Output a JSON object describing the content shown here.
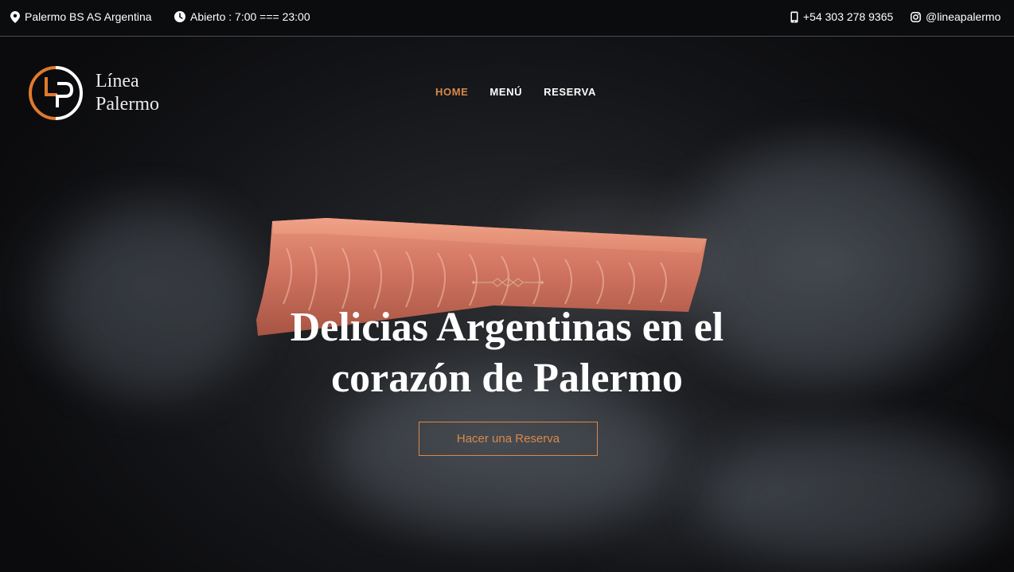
{
  "topbar": {
    "location": "Palermo BS AS Argentina",
    "hours": "Abierto : 7:00 === 23:00",
    "phone": "+54 303 278 9365",
    "instagram": "@lineapalermo"
  },
  "logo": {
    "line1": "Línea",
    "line2": "Palermo",
    "accent_color": "#e07a2e"
  },
  "nav": {
    "items": [
      {
        "label": "HOME",
        "active": true
      },
      {
        "label": "MENÚ",
        "active": false
      },
      {
        "label": "RESERVA",
        "active": false
      }
    ]
  },
  "hero": {
    "headline_line1": "Delicias Argentinas en el",
    "headline_line2": "corazón de Palermo",
    "cta_label": "Hacer una Reserva"
  },
  "colors": {
    "accent": "#d9894b",
    "background": "#0b0c0e"
  },
  "icons": [
    "location-pin-icon",
    "clock-icon",
    "phone-icon",
    "instagram-icon",
    "logo-mark-icon",
    "ornament-divider-icon"
  ]
}
